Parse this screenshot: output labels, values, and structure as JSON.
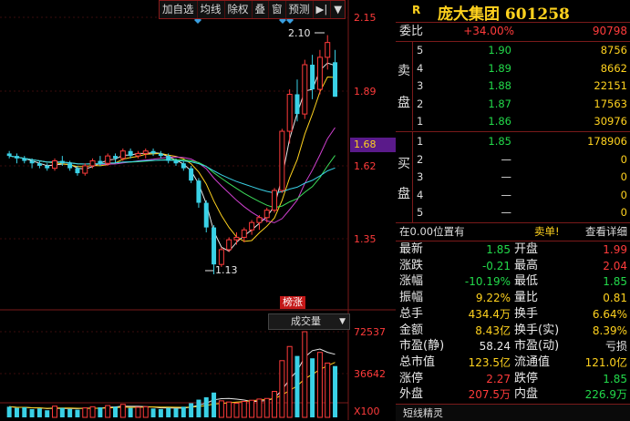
{
  "toolbar": {
    "buttons": [
      "加自选",
      "均线",
      "除权",
      "叠",
      "窗",
      "预测"
    ],
    "nav_glyph": "▶|",
    "menu_glyph": "▼"
  },
  "price_axis": {
    "labels": [
      "2.15",
      "1.89",
      "1.62",
      "1.35"
    ],
    "current": "1.68"
  },
  "annotations": {
    "high": "2.10",
    "low": "1.13",
    "tag": "榜涨"
  },
  "volume": {
    "indicator": "成交量",
    "labels": [
      "72537",
      "36642",
      "X100"
    ]
  },
  "stock": {
    "badge": "R",
    "title": "庞大集团 601258"
  },
  "weibi": {
    "label": "委比",
    "ratio": "+34.00%",
    "diff": "90798"
  },
  "sell_label": [
    "卖",
    "盘"
  ],
  "buy_label": [
    "买",
    "盘"
  ],
  "sell": [
    {
      "lvl": "5",
      "price": "1.90",
      "vol": "8756"
    },
    {
      "lvl": "4",
      "price": "1.89",
      "vol": "8662"
    },
    {
      "lvl": "3",
      "price": "1.88",
      "vol": "22151"
    },
    {
      "lvl": "2",
      "price": "1.87",
      "vol": "17563"
    },
    {
      "lvl": "1",
      "price": "1.86",
      "vol": "30976"
    }
  ],
  "buy": [
    {
      "lvl": "1",
      "price": "1.85",
      "vol": "178906"
    },
    {
      "lvl": "2",
      "price": "—",
      "vol": "0"
    },
    {
      "lvl": "3",
      "price": "—",
      "vol": "0"
    },
    {
      "lvl": "4",
      "price": "—",
      "vol": "0"
    },
    {
      "lvl": "5",
      "price": "—",
      "vol": "0"
    }
  ],
  "position_bar": {
    "left": "在0.00位置有",
    "mid": "卖单!",
    "right": "查看详细"
  },
  "stats": [
    {
      "k1": "最新",
      "v1": "1.85",
      "c1": "green",
      "k2": "开盘",
      "v2": "1.99",
      "c2": "red"
    },
    {
      "k1": "涨跌",
      "v1": "-0.21",
      "c1": "green",
      "k2": "最高",
      "v2": "2.04",
      "c2": "red"
    },
    {
      "k1": "涨幅",
      "v1": "-10.19%",
      "c1": "green",
      "k2": "最低",
      "v2": "1.85",
      "c2": "green"
    },
    {
      "k1": "振幅",
      "v1": "9.22%",
      "c1": "yellow",
      "k2": "量比",
      "v2": "0.81",
      "c2": "yellow"
    },
    {
      "k1": "总手",
      "v1": "434.4万",
      "c1": "yellow",
      "k2": "换手",
      "v2": "6.64%",
      "c2": "yellow"
    },
    {
      "k1": "金额",
      "v1": "8.43亿",
      "c1": "yellow",
      "k2": "换手(实)",
      "v2": "8.39%",
      "c2": "yellow"
    },
    {
      "k1": "市盈(静)",
      "v1": "58.24",
      "c1": "white",
      "k2": "市盈(动)",
      "v2": "亏损",
      "c2": "white"
    },
    {
      "k1": "总市值",
      "v1": "123.5亿",
      "c1": "yellow",
      "k2": "流通值",
      "v2": "121.0亿",
      "c2": "yellow"
    },
    {
      "k1": "涨停",
      "v1": "2.27",
      "c1": "red",
      "k2": "跌停",
      "v2": "1.85",
      "c2": "green"
    },
    {
      "k1": "外盘",
      "v1": "207.5万",
      "c1": "red",
      "k2": "内盘",
      "v2": "226.9万",
      "c2": "green"
    }
  ],
  "bottom": {
    "label": "短线精灵"
  },
  "colors": {
    "up": "#ff3b3b",
    "down": "#22d94a",
    "cyan_candle": "#3ad1e6",
    "ma_white": "#e8e8e8",
    "ma_yellow": "#ffd21e",
    "ma_green": "#3cdc5a",
    "ma_cyan": "#3ad1e6",
    "ma_magenta": "#d040d0",
    "grid": "#7a1a1a"
  },
  "chart_data": {
    "type": "candlestick",
    "ylim": [
      1.13,
      2.15
    ],
    "candles": [
      [
        1.62,
        1.63,
        1.6,
        1.61
      ],
      [
        1.61,
        1.62,
        1.58,
        1.6
      ],
      [
        1.6,
        1.61,
        1.58,
        1.59
      ],
      [
        1.59,
        1.6,
        1.56,
        1.58
      ],
      [
        1.58,
        1.59,
        1.56,
        1.57
      ],
      [
        1.57,
        1.58,
        1.55,
        1.56
      ],
      [
        1.56,
        1.6,
        1.55,
        1.59
      ],
      [
        1.59,
        1.61,
        1.57,
        1.58
      ],
      [
        1.58,
        1.59,
        1.55,
        1.56
      ],
      [
        1.56,
        1.57,
        1.53,
        1.54
      ],
      [
        1.54,
        1.58,
        1.53,
        1.57
      ],
      [
        1.57,
        1.6,
        1.56,
        1.59
      ],
      [
        1.59,
        1.61,
        1.57,
        1.58
      ],
      [
        1.58,
        1.62,
        1.57,
        1.61
      ],
      [
        1.61,
        1.62,
        1.58,
        1.6
      ],
      [
        1.6,
        1.64,
        1.59,
        1.63
      ],
      [
        1.63,
        1.64,
        1.6,
        1.61
      ],
      [
        1.61,
        1.63,
        1.6,
        1.62
      ],
      [
        1.62,
        1.64,
        1.6,
        1.63
      ],
      [
        1.63,
        1.64,
        1.61,
        1.62
      ],
      [
        1.62,
        1.63,
        1.6,
        1.61
      ],
      [
        1.61,
        1.62,
        1.58,
        1.59
      ],
      [
        1.59,
        1.6,
        1.57,
        1.58
      ],
      [
        1.58,
        1.59,
        1.55,
        1.56
      ],
      [
        1.56,
        1.57,
        1.5,
        1.51
      ],
      [
        1.51,
        1.52,
        1.4,
        1.42
      ],
      [
        1.42,
        1.43,
        1.3,
        1.32
      ],
      [
        1.32,
        1.33,
        1.13,
        1.17
      ],
      [
        1.17,
        1.24,
        1.16,
        1.23
      ],
      [
        1.23,
        1.28,
        1.22,
        1.27
      ],
      [
        1.27,
        1.3,
        1.25,
        1.28
      ],
      [
        1.28,
        1.32,
        1.26,
        1.31
      ],
      [
        1.31,
        1.35,
        1.29,
        1.34
      ],
      [
        1.34,
        1.37,
        1.31,
        1.36
      ],
      [
        1.36,
        1.4,
        1.34,
        1.39
      ],
      [
        1.39,
        1.48,
        1.38,
        1.47
      ],
      [
        1.47,
        1.72,
        1.46,
        1.71
      ],
      [
        1.71,
        1.88,
        1.66,
        1.86
      ],
      [
        1.86,
        1.92,
        1.75,
        1.78
      ],
      [
        1.78,
        2.0,
        1.76,
        1.98
      ],
      [
        1.98,
        2.02,
        1.84,
        1.88
      ],
      [
        1.88,
        2.04,
        1.86,
        2.01
      ],
      [
        2.01,
        2.1,
        1.96,
        2.07
      ],
      [
        1.99,
        2.04,
        1.85,
        1.85
      ]
    ],
    "volume_ylim": [
      0,
      72537
    ],
    "volumes": [
      9000,
      8000,
      8500,
      7000,
      7500,
      6000,
      9500,
      8000,
      7000,
      6500,
      8000,
      9000,
      8500,
      10000,
      9000,
      11000,
      8000,
      8500,
      9000,
      7500,
      7000,
      8000,
      7500,
      9000,
      12000,
      15000,
      17000,
      21000,
      14000,
      13000,
      12000,
      13500,
      14500,
      15500,
      16000,
      22000,
      48000,
      60000,
      52000,
      72537,
      50000,
      55000,
      46000,
      43440
    ]
  }
}
